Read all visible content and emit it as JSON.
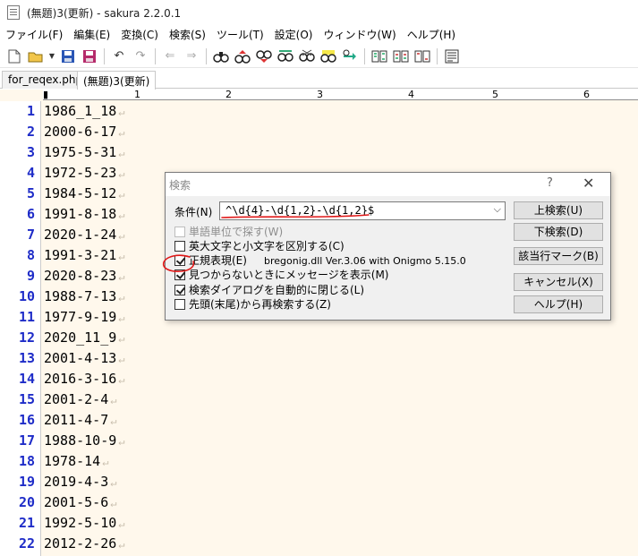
{
  "window": {
    "title": "(無題)3(更新) - sakura 2.2.0.1"
  },
  "menu": [
    "ファイル(F)",
    "編集(E)",
    "変換(C)",
    "検索(S)",
    "ツール(T)",
    "設定(O)",
    "ウィンドウ(W)",
    "ヘルプ(H)"
  ],
  "tabs": [
    {
      "label": "for_reqex.php",
      "active": false
    },
    {
      "label": "(無題)3(更新)",
      "active": true
    }
  ],
  "ruler": {
    "labels": [
      "1",
      "2",
      "3",
      "4",
      "5",
      "6"
    ]
  },
  "editor": {
    "eol_glyph": "↵",
    "lines": [
      {
        "num": "1",
        "text": "1986_1_18"
      },
      {
        "num": "2",
        "text": "2000-6-17"
      },
      {
        "num": "3",
        "text": "1975-5-31"
      },
      {
        "num": "4",
        "text": "1972-5-23"
      },
      {
        "num": "5",
        "text": "1984-5-12"
      },
      {
        "num": "6",
        "text": "1991-8-18"
      },
      {
        "num": "7",
        "text": "2020-1-24"
      },
      {
        "num": "8",
        "text": "1991-3-21"
      },
      {
        "num": "9",
        "text": "2020-8-23"
      },
      {
        "num": "10",
        "text": "1988-7-13"
      },
      {
        "num": "11",
        "text": "1977-9-19"
      },
      {
        "num": "12",
        "text": "2020_11_9"
      },
      {
        "num": "13",
        "text": "2001-4-13"
      },
      {
        "num": "14",
        "text": "2016-3-16"
      },
      {
        "num": "15",
        "text": "2001-2-4"
      },
      {
        "num": "16",
        "text": "2011-4-7"
      },
      {
        "num": "17",
        "text": "1988-10-9"
      },
      {
        "num": "18",
        "text": "1978-14"
      },
      {
        "num": "19",
        "text": "2019-4-3"
      },
      {
        "num": "20",
        "text": "2001-5-6"
      },
      {
        "num": "21",
        "text": "1992-5-10"
      },
      {
        "num": "22",
        "text": "2012-2-26"
      }
    ]
  },
  "dialog": {
    "title": "検索",
    "help_glyph": "?",
    "close_glyph": "✕",
    "condition_label": "条件(N)",
    "condition_value": "^\\d{4}-\\d{1,2}-\\d{1,2}$",
    "options": {
      "word_unit": {
        "label": "単語単位で探す(W)",
        "checked": false,
        "enabled": false
      },
      "match_case": {
        "label": "英大文字と小文字を区別する(C)",
        "checked": false,
        "enabled": true
      },
      "regex": {
        "label": "正規表現(E)",
        "checked": true,
        "enabled": true
      },
      "notify": {
        "label": "見つからないときにメッセージを表示(M)",
        "checked": true,
        "enabled": true
      },
      "auto_close": {
        "label": "検索ダイアログを自動的に閉じる(L)",
        "checked": true,
        "enabled": true
      },
      "wrap": {
        "label": "先頭(末尾)から再検索する(Z)",
        "checked": false,
        "enabled": true
      }
    },
    "dll_info": "bregonig.dll Ver.3.06 with Onigmo 5.15.0",
    "buttons": {
      "search_up": "上検索(U)",
      "search_down": "下検索(D)",
      "mark_lines": "該当行マーク(B)",
      "cancel": "キャンセル(X)",
      "help": "ヘルプ(H)"
    }
  },
  "colors": {
    "line_number": "#1e2cc8",
    "editor_bg": "#fff8ec",
    "annotation": "#e01818"
  }
}
